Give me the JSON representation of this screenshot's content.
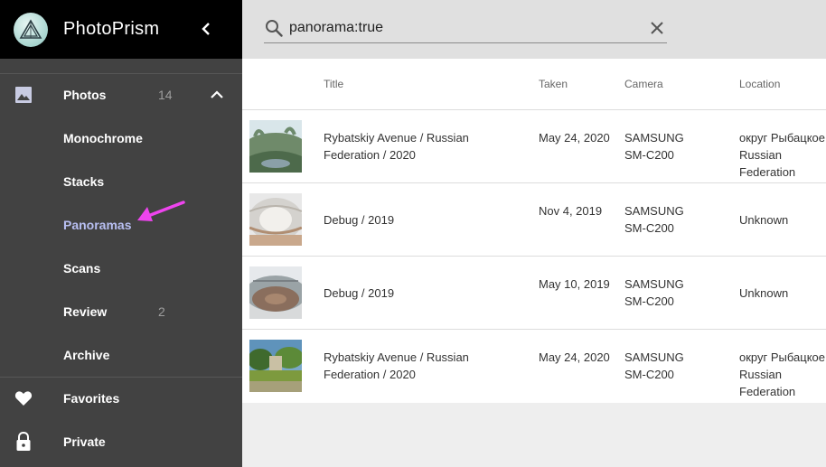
{
  "app": {
    "title": "PhotoPrism"
  },
  "sidebar": {
    "items": [
      {
        "id": "photos",
        "label": "Photos",
        "count": "14",
        "icon": "image-icon"
      },
      {
        "id": "monochrome",
        "label": "Monochrome"
      },
      {
        "id": "stacks",
        "label": "Stacks"
      },
      {
        "id": "panoramas",
        "label": "Panoramas"
      },
      {
        "id": "scans",
        "label": "Scans"
      },
      {
        "id": "review",
        "label": "Review",
        "count": "2"
      },
      {
        "id": "archive",
        "label": "Archive"
      },
      {
        "id": "favorites",
        "label": "Favorites",
        "icon": "heart-icon"
      },
      {
        "id": "private",
        "label": "Private",
        "icon": "lock-icon"
      }
    ],
    "active_color": "#b8bff2"
  },
  "search": {
    "value": "panorama:true"
  },
  "table": {
    "headers": {
      "title": "Title",
      "taken": "Taken",
      "camera": "Camera",
      "location": "Location"
    },
    "rows": [
      {
        "title": "Rybatskiy Avenue / Russian Federation / 2020",
        "taken": "May 24, 2020",
        "camera": "SAMSUNG SM-C200",
        "location": "округ Рыбацкое Russian Federation"
      },
      {
        "title": "Debug / 2019",
        "taken": "Nov 4, 2019",
        "camera": "SAMSUNG SM-C200",
        "location": "Unknown"
      },
      {
        "title": "Debug / 2019",
        "taken": "May 10, 2019",
        "camera": "SAMSUNG SM-C200",
        "location": "Unknown"
      },
      {
        "title": "Rybatskiy Avenue / Russian Federation / 2020",
        "taken": "May 24, 2020",
        "camera": "SAMSUNG SM-C200",
        "location": "округ Рыбацкое Russian Federation"
      }
    ]
  },
  "annotation": {
    "arrow_color": "#ee44ee"
  }
}
